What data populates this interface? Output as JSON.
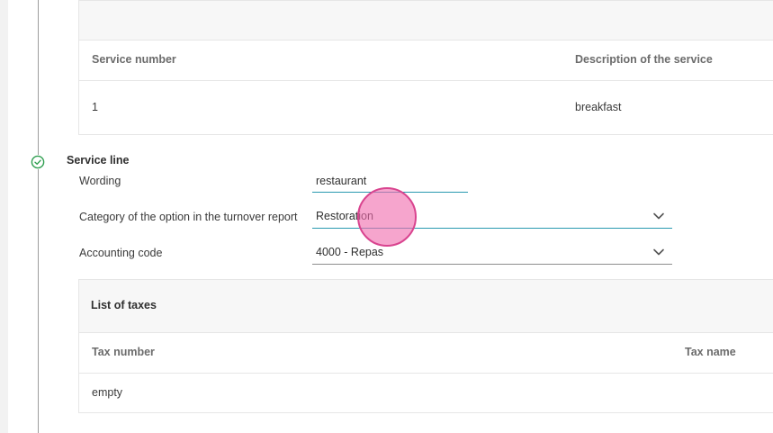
{
  "services_table": {
    "headers": [
      "Service number",
      "Description of the service"
    ],
    "rows": [
      [
        "1",
        "breakfast"
      ]
    ]
  },
  "service_line": {
    "title": "Service line",
    "wording_label": "Wording",
    "wording_value": "restaurant",
    "category_label": "Category of the option in the turnover report",
    "category_value": "Restoration",
    "accounting_label": "Accounting code",
    "accounting_value": "4000 - Repas"
  },
  "taxes": {
    "title": "List of taxes",
    "headers": [
      "Tax number",
      "Tax name"
    ],
    "empty_text": "empty"
  },
  "colors": {
    "focus_underline": "#2a9ab0",
    "step_check": "#2e9e4f",
    "cursor_highlight": "#f06eaf"
  },
  "icons": {
    "step": "check-circle-icon",
    "dropdown": "chevron-down-icon"
  }
}
